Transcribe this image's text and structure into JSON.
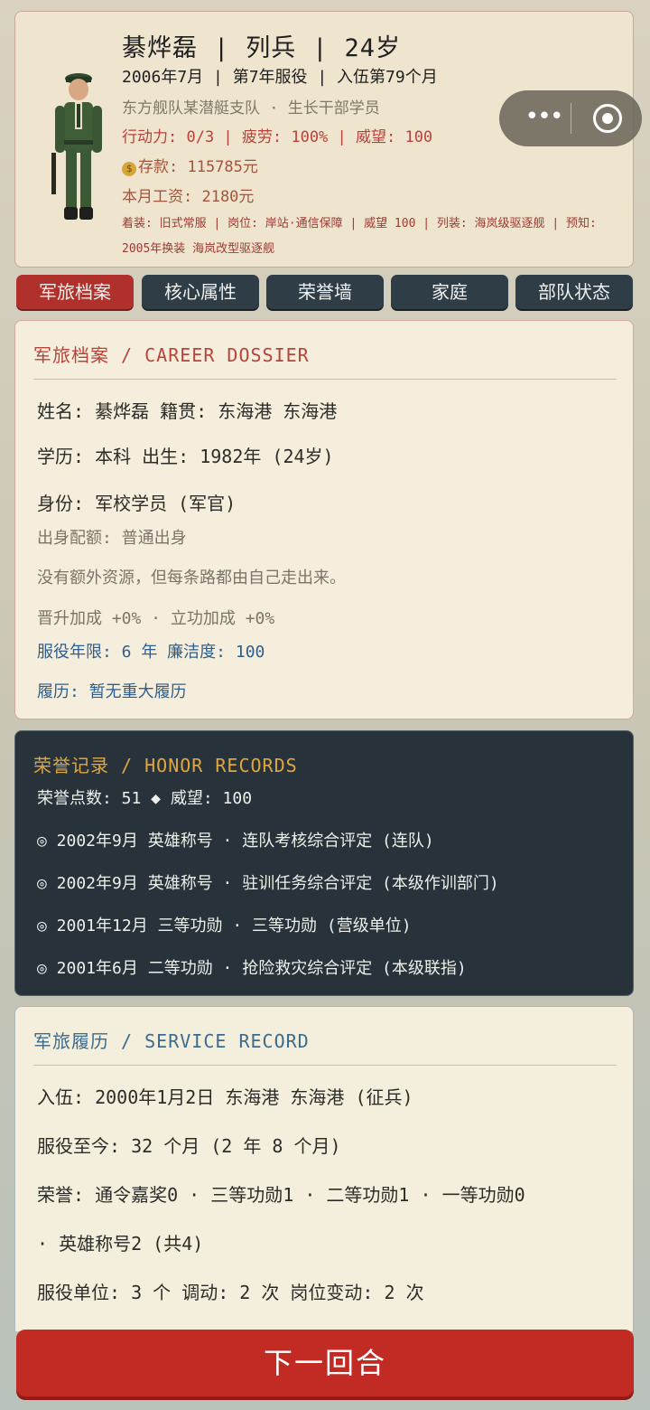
{
  "header": {
    "name": "綦烨磊",
    "rank": "列兵",
    "age": "24岁",
    "date_line": "2006年7月  |  第7年服役  |  入伍第79个月",
    "unit_line": "东方舰队某潜艇支队 · 生长干部学员",
    "status_line": "行动力: 0/3  |  疲劳: 100%  |  威望: 100",
    "savings": "存款: 115785元",
    "salary": "本月工资: 2180元",
    "extra_info": "着装: 旧式常服 | 岗位: 岸站·通信保障 | 威望 100 | 列装: 海岚级驱逐舰 | 预知: 2005年换装 海岚改型驱逐舰"
  },
  "tabs": [
    {
      "label": "军旅档案",
      "active": true
    },
    {
      "label": "核心属性",
      "active": false
    },
    {
      "label": "荣誉墙",
      "active": false
    },
    {
      "label": "家庭",
      "active": false
    },
    {
      "label": "部队状态",
      "active": false
    }
  ],
  "dossier": {
    "title": "军旅档案 / CAREER DOSSIER",
    "name_line": "姓名: 綦烨磊     籍贯: 东海港 东海港",
    "edu_line": "学历: 本科     出生: 1982年 (24岁)",
    "identity_line": "身份: 军校学员 (军官)",
    "origin_line": "出身配额: 普通出身",
    "origin_desc": "没有额外资源，但每条路都由自己走出来。",
    "bonus_line": "晋升加成 +0%  ·  立功加成 +0%",
    "term_line": "服役年限: 6 年  廉洁度: 100",
    "history_line": "履历: 暂无重大履历"
  },
  "honor": {
    "title": "荣誉记录 / HONOR RECORDS",
    "points_line": "荣誉点数: 51 ◆  威望: 100",
    "records": [
      "◎ 2002年9月 英雄称号 · 连队考核综合评定 (连队)",
      "◎ 2002年9月 英雄称号 · 驻训任务综合评定 (本级作训部门)",
      "◎ 2001年12月 三等功勋 · 三等功勋 (营级单位)",
      "◎ 2001年6月 二等功勋 · 抢险救灾综合评定 (本级联指)"
    ]
  },
  "service": {
    "title": "军旅履历 / SERVICE RECORD",
    "enlist_line": "入伍: 2000年1月2日  东海港 东海港   (征兵)",
    "duration_line": "服役至今: 32 个月 (2 年 8 个月)",
    "honors_line": "荣誉: 通令嘉奖0 · 三等功勋1 · 二等功勋1 · 一等功勋0",
    "honors_line2": "· 英雄称号2 (共4)",
    "units_line": "服役单位: 3 个  调动: 2 次  岗位变动: 2 次"
  },
  "next_button": "下一回合"
}
